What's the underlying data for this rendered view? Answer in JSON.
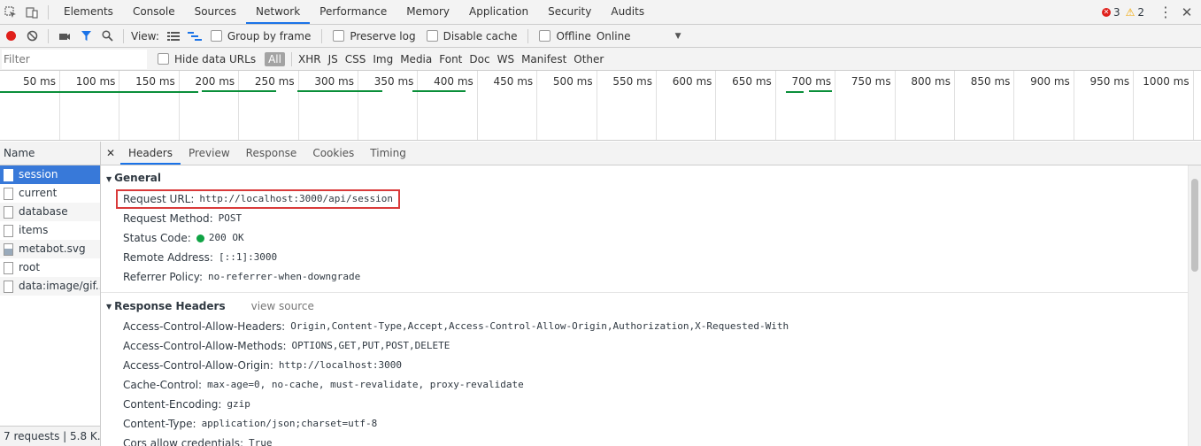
{
  "main_tabs": [
    "Elements",
    "Console",
    "Sources",
    "Network",
    "Performance",
    "Memory",
    "Application",
    "Security",
    "Audits"
  ],
  "errors": "3",
  "warnings": "2",
  "toolbar": {
    "view_label": "View:",
    "group_by_frame": "Group by frame",
    "preserve_log": "Preserve log",
    "disable_cache": "Disable cache",
    "offline": "Offline",
    "throttle": "Online"
  },
  "filter": {
    "placeholder": "Filter",
    "hide_data_urls": "Hide data URLs",
    "types": [
      "All",
      "XHR",
      "JS",
      "CSS",
      "Img",
      "Media",
      "Font",
      "Doc",
      "WS",
      "Manifest",
      "Other"
    ]
  },
  "timeline_ticks": [
    "50 ms",
    "100 ms",
    "150 ms",
    "200 ms",
    "250 ms",
    "300 ms",
    "350 ms",
    "400 ms",
    "450 ms",
    "500 ms",
    "550 ms",
    "600 ms",
    "650 ms",
    "700 ms",
    "750 ms",
    "800 ms",
    "850 ms",
    "900 ms",
    "950 ms",
    "1000 ms"
  ],
  "requests": {
    "header": "Name",
    "items": [
      "session",
      "current",
      "database",
      "items",
      "metabot.svg",
      "root",
      "data:image/gif..."
    ],
    "status": "7 requests | 5.8 K..."
  },
  "detail_tabs": [
    "Headers",
    "Preview",
    "Response",
    "Cookies",
    "Timing"
  ],
  "general": {
    "title": "General",
    "request_url_key": "Request URL:",
    "request_url": "http://localhost:3000/api/session",
    "method_key": "Request Method:",
    "method": "POST",
    "status_key": "Status Code:",
    "status": "200 OK",
    "remote_key": "Remote Address:",
    "remote": "[::1]:3000",
    "referrer_key": "Referrer Policy:",
    "referrer": "no-referrer-when-downgrade"
  },
  "response_headers": {
    "title": "Response Headers",
    "view_source": "view source",
    "rows": [
      {
        "k": "Access-Control-Allow-Headers:",
        "v": "Origin,Content-Type,Accept,Access-Control-Allow-Origin,Authorization,X-Requested-With"
      },
      {
        "k": "Access-Control-Allow-Methods:",
        "v": "OPTIONS,GET,PUT,POST,DELETE"
      },
      {
        "k": "Access-Control-Allow-Origin:",
        "v": "http://localhost:3000"
      },
      {
        "k": "Cache-Control:",
        "v": "max-age=0, no-cache, must-revalidate, proxy-revalidate"
      },
      {
        "k": "Content-Encoding:",
        "v": "gzip"
      },
      {
        "k": "Content-Type:",
        "v": "application/json;charset=utf-8"
      },
      {
        "k": "Cors allow credentials:",
        "v": "True"
      }
    ]
  },
  "colors": {
    "record": "#e0201b",
    "filter_icon": "#1a73e8",
    "status_ok": "#0fa344",
    "highlight": "#d93a3a",
    "selected": "#3879d9"
  }
}
